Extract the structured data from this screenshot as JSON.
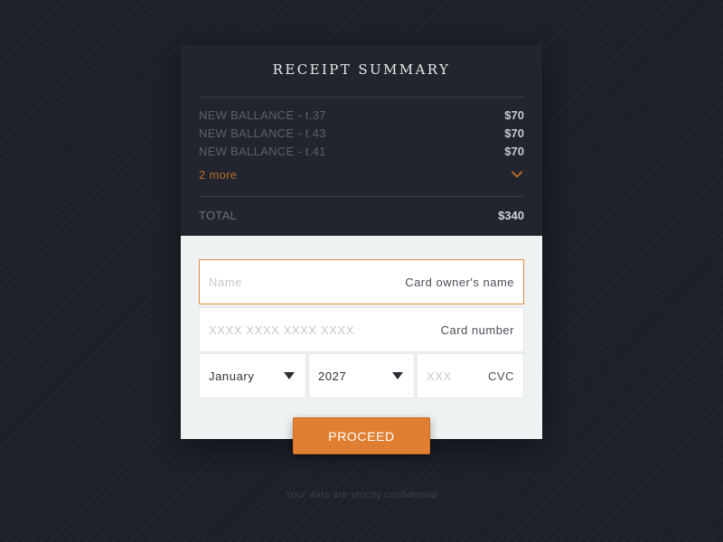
{
  "summary": {
    "title": "RECEIPT SUMMARY",
    "items": [
      {
        "name": "NEW BALLANCE - t.37",
        "price": "$70"
      },
      {
        "name": "NEW BALLANCE - t.43",
        "price": "$70"
      },
      {
        "name": "NEW BALLANCE - t.41",
        "price": "$70"
      }
    ],
    "more_label": "2 more",
    "more_icon": "chevron-down-icon",
    "total_label": "TOTAL",
    "total_value": "$340"
  },
  "form": {
    "name": {
      "value": "",
      "placeholder": "Name",
      "hint": "Card owner's name"
    },
    "card_number": {
      "value": "",
      "placeholder": "XXXX XXXX XXXX XXXX",
      "hint": "Card number"
    },
    "month": {
      "selected": "January"
    },
    "year": {
      "selected": "2027"
    },
    "cvc": {
      "value": "",
      "placeholder": "XXX",
      "hint": "CVC"
    }
  },
  "proceed_label": "PROCEED",
  "footnote": "Your data are strictly confidential",
  "colors": {
    "accent": "#e07f31",
    "background": "#1d2028",
    "panel": "#22252d",
    "form_bg": "#eff2f3"
  }
}
